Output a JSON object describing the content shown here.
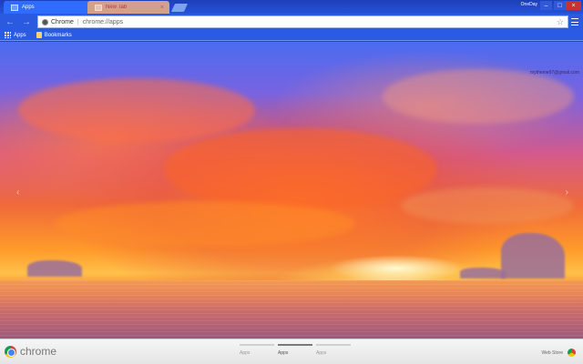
{
  "tabs": [
    {
      "label": "Apps",
      "active": true,
      "close": "×"
    },
    {
      "label": "New Tab",
      "active": false,
      "close": "×"
    }
  ],
  "window": {
    "user": "OneDay",
    "minimize": "–",
    "maximize": "□",
    "close": "×"
  },
  "toolbar": {
    "back": "←",
    "forward": "→",
    "reload": "↻",
    "omnibox": {
      "site": "Chrome",
      "separator": "|",
      "url": "chrome://apps",
      "bookmark_star": "☆"
    }
  },
  "bookmarks": [
    {
      "label": "Apps"
    },
    {
      "label": "Bookmarks"
    }
  ],
  "content": {
    "account": "mytheme97@gmail.com",
    "prev_arrow": "‹",
    "next_arrow": "›"
  },
  "footer": {
    "brand": "chrome",
    "page_tabs": [
      {
        "label": "Apps",
        "active": false
      },
      {
        "label": "Apps",
        "active": true
      },
      {
        "label": "Apps",
        "active": false
      }
    ],
    "web_store": "Web Store"
  },
  "colors": {
    "frame": "#2a5ae0",
    "active_tab": "#2f6cff",
    "close_button": "#c9322f"
  }
}
